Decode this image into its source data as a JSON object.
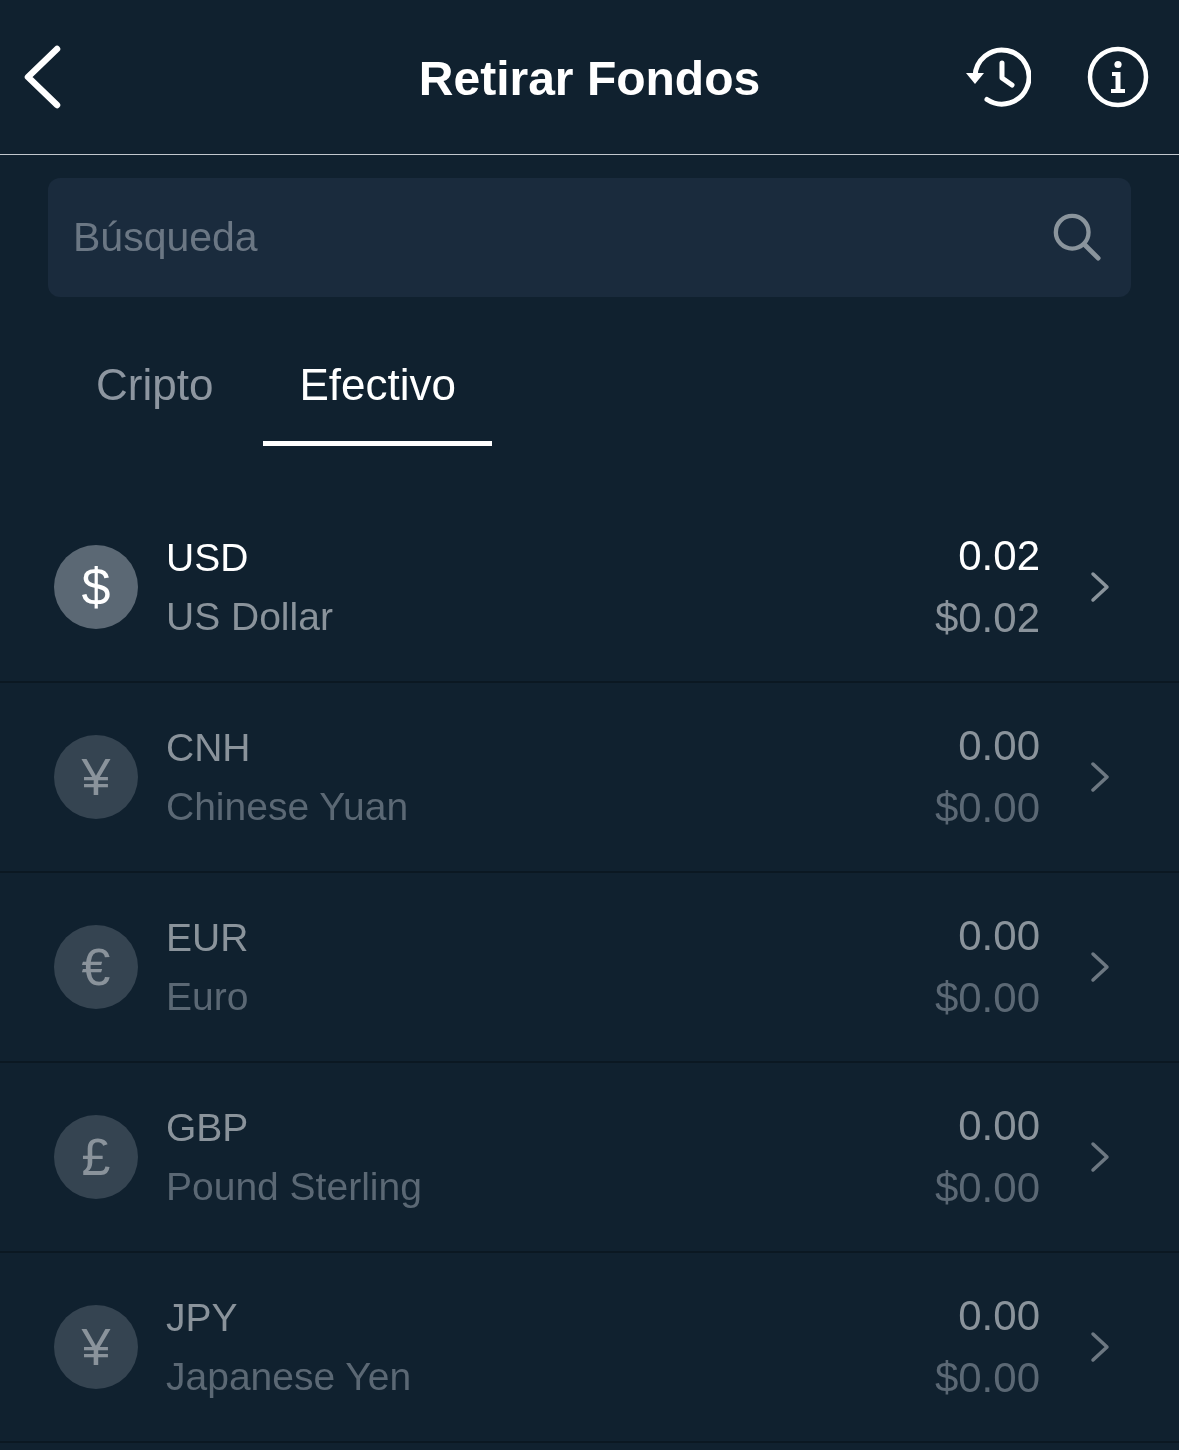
{
  "header": {
    "title": "Retirar Fondos"
  },
  "search": {
    "placeholder": "Búsqueda"
  },
  "tabs": [
    {
      "label": "Cripto",
      "selected": false
    },
    {
      "label": "Efectivo",
      "selected": true
    }
  ],
  "currencies": [
    {
      "symbol": "$",
      "code": "USD",
      "name": "US Dollar",
      "amount": "0.02",
      "value": "$0.02",
      "disabled": false
    },
    {
      "symbol": "¥",
      "code": "CNH",
      "name": "Chinese Yuan",
      "amount": "0.00",
      "value": "$0.00",
      "disabled": true
    },
    {
      "symbol": "€",
      "code": "EUR",
      "name": "Euro",
      "amount": "0.00",
      "value": "$0.00",
      "disabled": true
    },
    {
      "symbol": "£",
      "code": "GBP",
      "name": "Pound Sterling",
      "amount": "0.00",
      "value": "$0.00",
      "disabled": true
    },
    {
      "symbol": "¥",
      "code": "JPY",
      "name": "Japanese Yen",
      "amount": "0.00",
      "value": "$0.00",
      "disabled": true
    }
  ]
}
